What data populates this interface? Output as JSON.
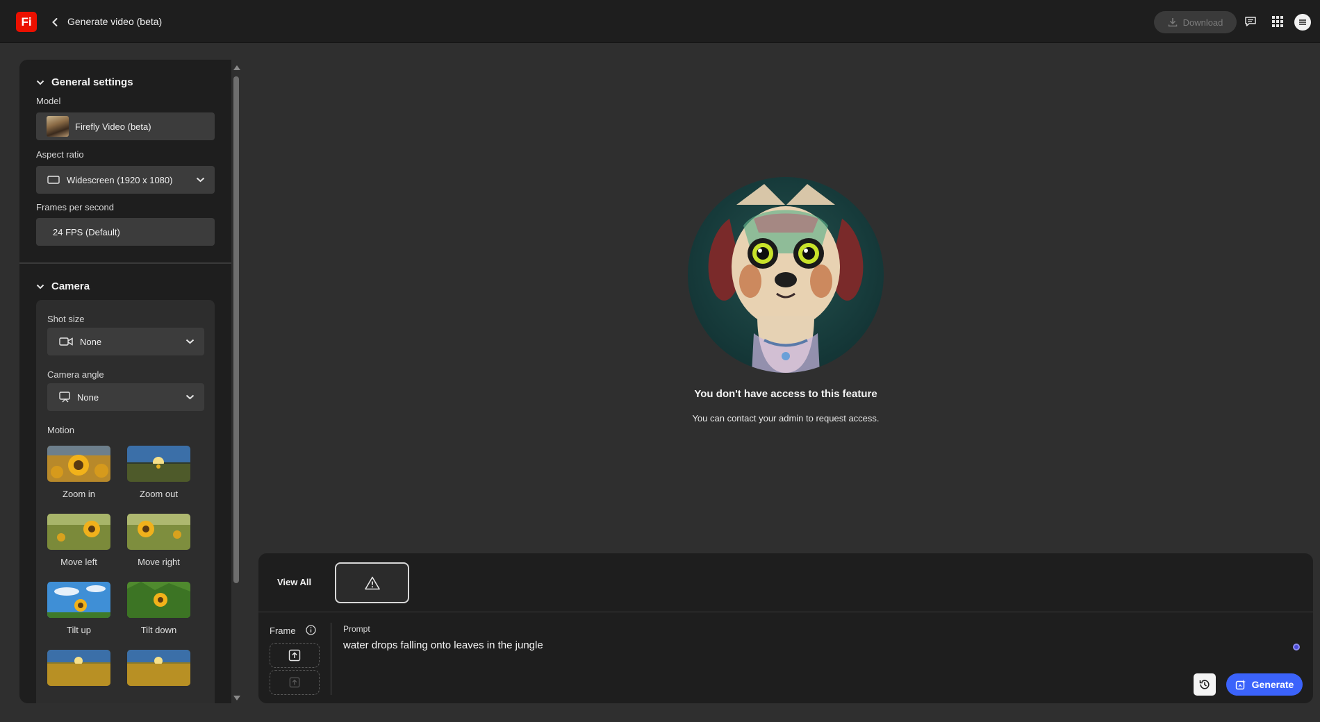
{
  "app": {
    "logo_text": "Fi",
    "page_title": "Generate video (beta)",
    "brand_color": "#eb1000",
    "accent_color": "#3b63fb"
  },
  "topbar": {
    "download_label": "Download",
    "icons": [
      "download-icon",
      "feedback-icon",
      "apps-grid-icon",
      "avatar"
    ]
  },
  "sidebar": {
    "general_settings": {
      "title": "General settings",
      "model_label": "Model",
      "model_value": "Firefly Video (beta)",
      "aspect_label": "Aspect ratio",
      "aspect_value": "Widescreen (1920 x 1080)",
      "fps_label": "Frames per second",
      "fps_value": "24 FPS (Default)"
    },
    "camera": {
      "title": "Camera",
      "shot_size_label": "Shot size",
      "shot_size_value": "None",
      "camera_angle_label": "Camera angle",
      "camera_angle_value": "None",
      "motion_label": "Motion",
      "motion_items": [
        {
          "label": "Zoom in"
        },
        {
          "label": "Zoom out"
        },
        {
          "label": "Move left"
        },
        {
          "label": "Move right"
        },
        {
          "label": "Tilt up"
        },
        {
          "label": "Tilt down"
        },
        {
          "label": ""
        },
        {
          "label": ""
        }
      ]
    }
  },
  "main": {
    "message_title": "You don't have access to this feature",
    "message_subtitle": "You can contact your admin to request access."
  },
  "prompt_panel": {
    "view_all_label": "View All",
    "frame_label": "Frame",
    "prompt_label": "Prompt",
    "prompt_value": "water drops falling onto leaves in the jungle",
    "generate_label": "Generate"
  }
}
